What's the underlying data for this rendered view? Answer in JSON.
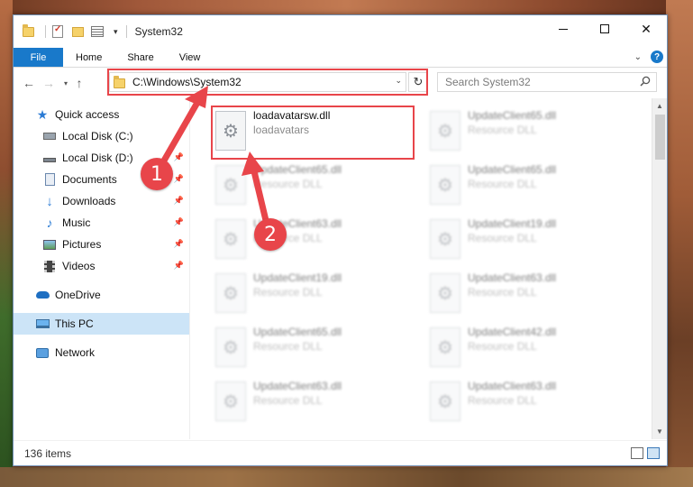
{
  "window": {
    "title": "System32",
    "controls": {
      "minimize": "—",
      "maximize": "□",
      "close": "✕"
    }
  },
  "ribbon": {
    "tabs": [
      "File",
      "Home",
      "Share",
      "View"
    ],
    "expand_icon": "chevron-down-icon",
    "help_label": "?"
  },
  "address": {
    "path": "C:\\Windows\\System32",
    "search_placeholder": "Search System32"
  },
  "sidebar": {
    "items": [
      {
        "label": "Quick access",
        "icon": "star-icon"
      },
      {
        "label": "Local Disk (C:)",
        "icon": "drive-icon"
      },
      {
        "label": "Local Disk (D:)",
        "icon": "drive-icon"
      },
      {
        "label": "Documents",
        "icon": "documents-icon"
      },
      {
        "label": "Downloads",
        "icon": "download-icon"
      },
      {
        "label": "Music",
        "icon": "music-icon"
      },
      {
        "label": "Pictures",
        "icon": "pictures-icon"
      },
      {
        "label": "Videos",
        "icon": "videos-icon"
      },
      {
        "label": "OneDrive",
        "icon": "cloud-icon"
      },
      {
        "label": "This PC",
        "icon": "computer-icon"
      },
      {
        "label": "Network",
        "icon": "network-icon"
      }
    ]
  },
  "files": [
    {
      "name": "loadavatarsw.dll",
      "type": "loadavatars"
    },
    {
      "name": "UpdateClient65.dll",
      "type": "Resource DLL"
    },
    {
      "name": "UpdateClient65.dll",
      "type": "Resource DLL"
    },
    {
      "name": "UpdateClient65.dll",
      "type": "Resource DLL"
    },
    {
      "name": "UpdateClient63.dll",
      "type": "Resource DLL"
    },
    {
      "name": "UpdateClient19.dll",
      "type": "Resource DLL"
    },
    {
      "name": "UpdateClient19.dll",
      "type": "Resource DLL"
    },
    {
      "name": "UpdateClient63.dll",
      "type": "Resource DLL"
    },
    {
      "name": "UpdateClient65.dll",
      "type": "Resource DLL"
    },
    {
      "name": "UpdateClient42.dll",
      "type": "Resource DLL"
    },
    {
      "name": "UpdateClient63.dll",
      "type": "Resource DLL"
    },
    {
      "name": "UpdateClient63.dll",
      "type": "Resource DLL"
    }
  ],
  "status": {
    "item_count": "136 items"
  },
  "annotations": {
    "step1": "1",
    "step2": "2",
    "color": "#e8454a"
  }
}
